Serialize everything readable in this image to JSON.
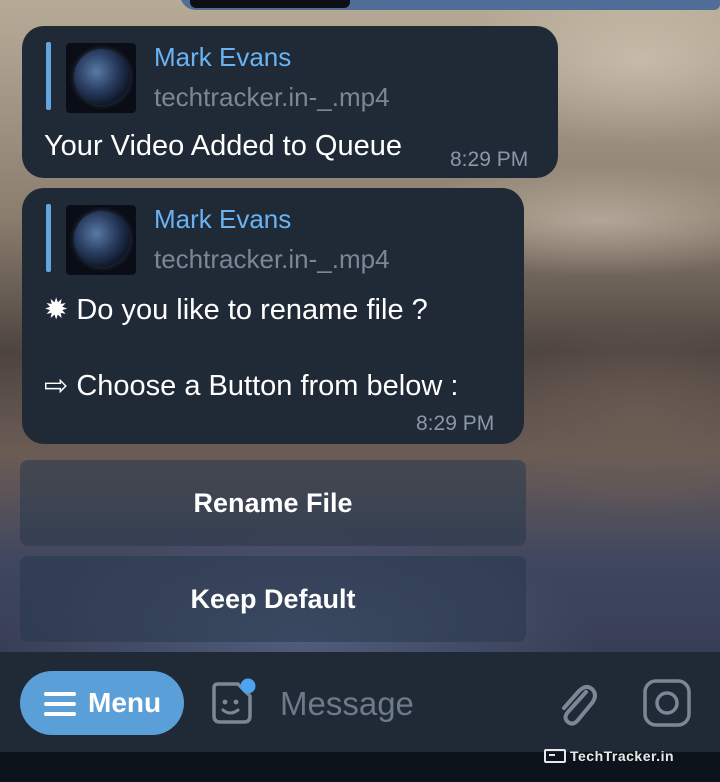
{
  "messages": [
    {
      "reply": {
        "author": "Mark Evans",
        "file": "techtracker.in-_.mp4"
      },
      "text": "Your Video Added to Queue",
      "time": "8:29 PM"
    },
    {
      "reply": {
        "author": "Mark Evans",
        "file": "techtracker.in-_.mp4"
      },
      "line1": "✹ Do you like to rename file ?",
      "line2": "⇨ Choose a Button from below :",
      "time": "8:29 PM"
    }
  ],
  "keyboard": {
    "rename_label": "Rename File",
    "keep_label": "Keep Default"
  },
  "input_bar": {
    "menu_label": "Menu",
    "message_placeholder": "Message"
  },
  "watermark": "TechTracker.in",
  "colors": {
    "bubble": "#1f2a36",
    "accent": "#6ab3f3",
    "menu_button": "#5b9fd8",
    "badge": "#4ea3f1"
  }
}
